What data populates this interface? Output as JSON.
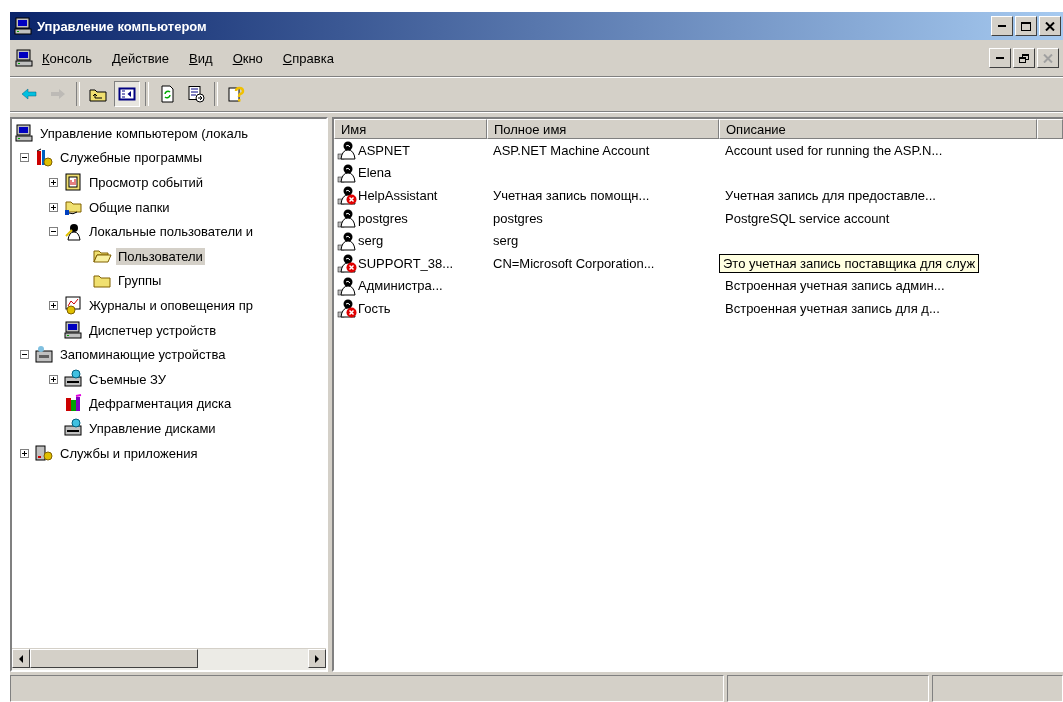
{
  "window": {
    "title": "Управление компьютером",
    "controls": [
      {
        "kind": "minimize",
        "disabled": false
      },
      {
        "kind": "maximize",
        "disabled": false
      },
      {
        "kind": "close",
        "disabled": false
      }
    ]
  },
  "menu_bar": {
    "items": [
      "Консоль",
      "Действие",
      "Вид",
      "Окно",
      "Справка"
    ],
    "child_controls": [
      {
        "kind": "minimize",
        "disabled": false
      },
      {
        "kind": "restore",
        "disabled": false
      },
      {
        "kind": "close",
        "disabled": true
      }
    ]
  },
  "toolbar": [
    {
      "kind": "back",
      "disabled": false,
      "pressed": false
    },
    {
      "kind": "forward",
      "disabled": true,
      "pressed": false
    },
    {
      "kind": "separator"
    },
    {
      "kind": "up",
      "disabled": false,
      "pressed": false
    },
    {
      "kind": "tree",
      "disabled": false,
      "pressed": true
    },
    {
      "kind": "separator"
    },
    {
      "kind": "refresh",
      "disabled": false,
      "pressed": false
    },
    {
      "kind": "export",
      "disabled": false,
      "pressed": false
    },
    {
      "kind": "separator"
    },
    {
      "kind": "help",
      "disabled": false,
      "pressed": false
    }
  ],
  "tree": [
    {
      "label": "Управление компьютером (локаль",
      "kind": "computer",
      "selected": false,
      "children": [
        {
          "label": "Служебные программы",
          "kind": "tools",
          "expanded": true,
          "selected": false,
          "children": [
            {
              "label": "Просмотр событий",
              "kind": "viewer",
              "expanded": false,
              "selected": false
            },
            {
              "label": "Общие папки",
              "kind": "share",
              "expanded": false,
              "selected": false
            },
            {
              "label": "Локальные пользователи и",
              "kind": "users",
              "expanded": true,
              "selected": false,
              "children": [
                {
                  "label": "Пользователи",
                  "kind": "openfolder",
                  "selected": true
                },
                {
                  "label": "Группы",
                  "kind": "folder",
                  "selected": false
                }
              ]
            },
            {
              "label": "Журналы и оповещения пр",
              "kind": "chart",
              "expanded": false,
              "selected": false
            },
            {
              "label": "Диспетчер устройств",
              "kind": "computer",
              "selected": false
            }
          ]
        },
        {
          "label": "Запоминающие устройства",
          "kind": "storage",
          "expanded": true,
          "selected": false,
          "children": [
            {
              "label": "Съемные ЗУ",
              "kind": "drive",
              "expanded": false,
              "selected": false
            },
            {
              "label": "Дефрагментация диска",
              "kind": "defrag",
              "selected": false
            },
            {
              "label": "Управление дисками",
              "kind": "drive",
              "selected": false
            }
          ]
        },
        {
          "label": "Службы и приложения",
          "kind": "services",
          "expanded": false,
          "selected": false
        }
      ]
    }
  ],
  "table": {
    "columns": [
      "Имя",
      "Полное имя",
      "Описание"
    ],
    "rows": [
      {
        "name": "ASPNET",
        "full_name": "ASP.NET Machine Account",
        "description": "Account used for running the ASP.N...",
        "disabled": false,
        "tooltip": false
      },
      {
        "name": "Elena",
        "disabled": false,
        "tooltip": false
      },
      {
        "name": "HelpAssistant",
        "full_name": "Учетная запись помощн...",
        "description": "Учетная запись для предоставле...",
        "disabled": true,
        "tooltip": false
      },
      {
        "name": "postgres",
        "full_name": "postgres",
        "description": "PostgreSQL service account",
        "disabled": false,
        "tooltip": false
      },
      {
        "name": "serg",
        "full_name": "serg",
        "disabled": false,
        "tooltip": false
      },
      {
        "name": "SUPPORT_38...",
        "full_name": "CN=Microsoft Corporation...",
        "description": "Это учетная запись поставщика для служ",
        "disabled": true,
        "tooltip": true
      },
      {
        "name": "Администра...",
        "description": "Встроенная учетная запись админ...",
        "disabled": false,
        "tooltip": false
      },
      {
        "name": "Гость",
        "description": "Встроенная учетная запись для д...",
        "disabled": true,
        "tooltip": false
      }
    ]
  }
}
